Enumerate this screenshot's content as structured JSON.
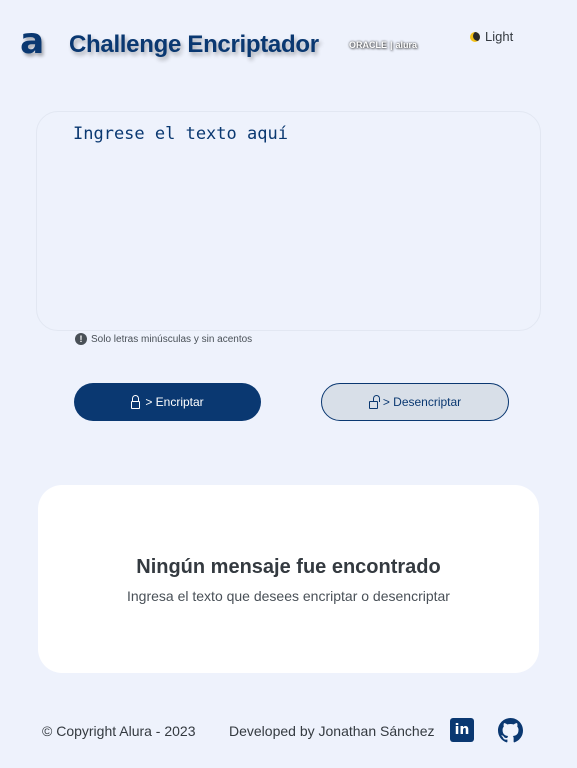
{
  "header": {
    "logo_text": "a",
    "title": "Challenge Encriptador",
    "partners": [
      "ORACLE",
      "alura"
    ],
    "theme_label": "Light"
  },
  "input": {
    "placeholder": "Ingrese el texto aquí",
    "value": ""
  },
  "hint": "Solo letras minúsculas y sin acentos",
  "buttons": {
    "encrypt": "> Encriptar",
    "decrypt": "> Desencriptar"
  },
  "result": {
    "title": "Ningún mensaje fue encontrado",
    "subtitle": "Ingresa el texto que desees encriptar o desencriptar"
  },
  "footer": {
    "copyright": "© Copyright Alura - 2023",
    "developer": "Developed by Jonathan Sánchez",
    "linkedin_glyph": "in"
  },
  "colors": {
    "primary": "#0a3871",
    "background": "#eef2fc",
    "card": "#ffffff"
  }
}
